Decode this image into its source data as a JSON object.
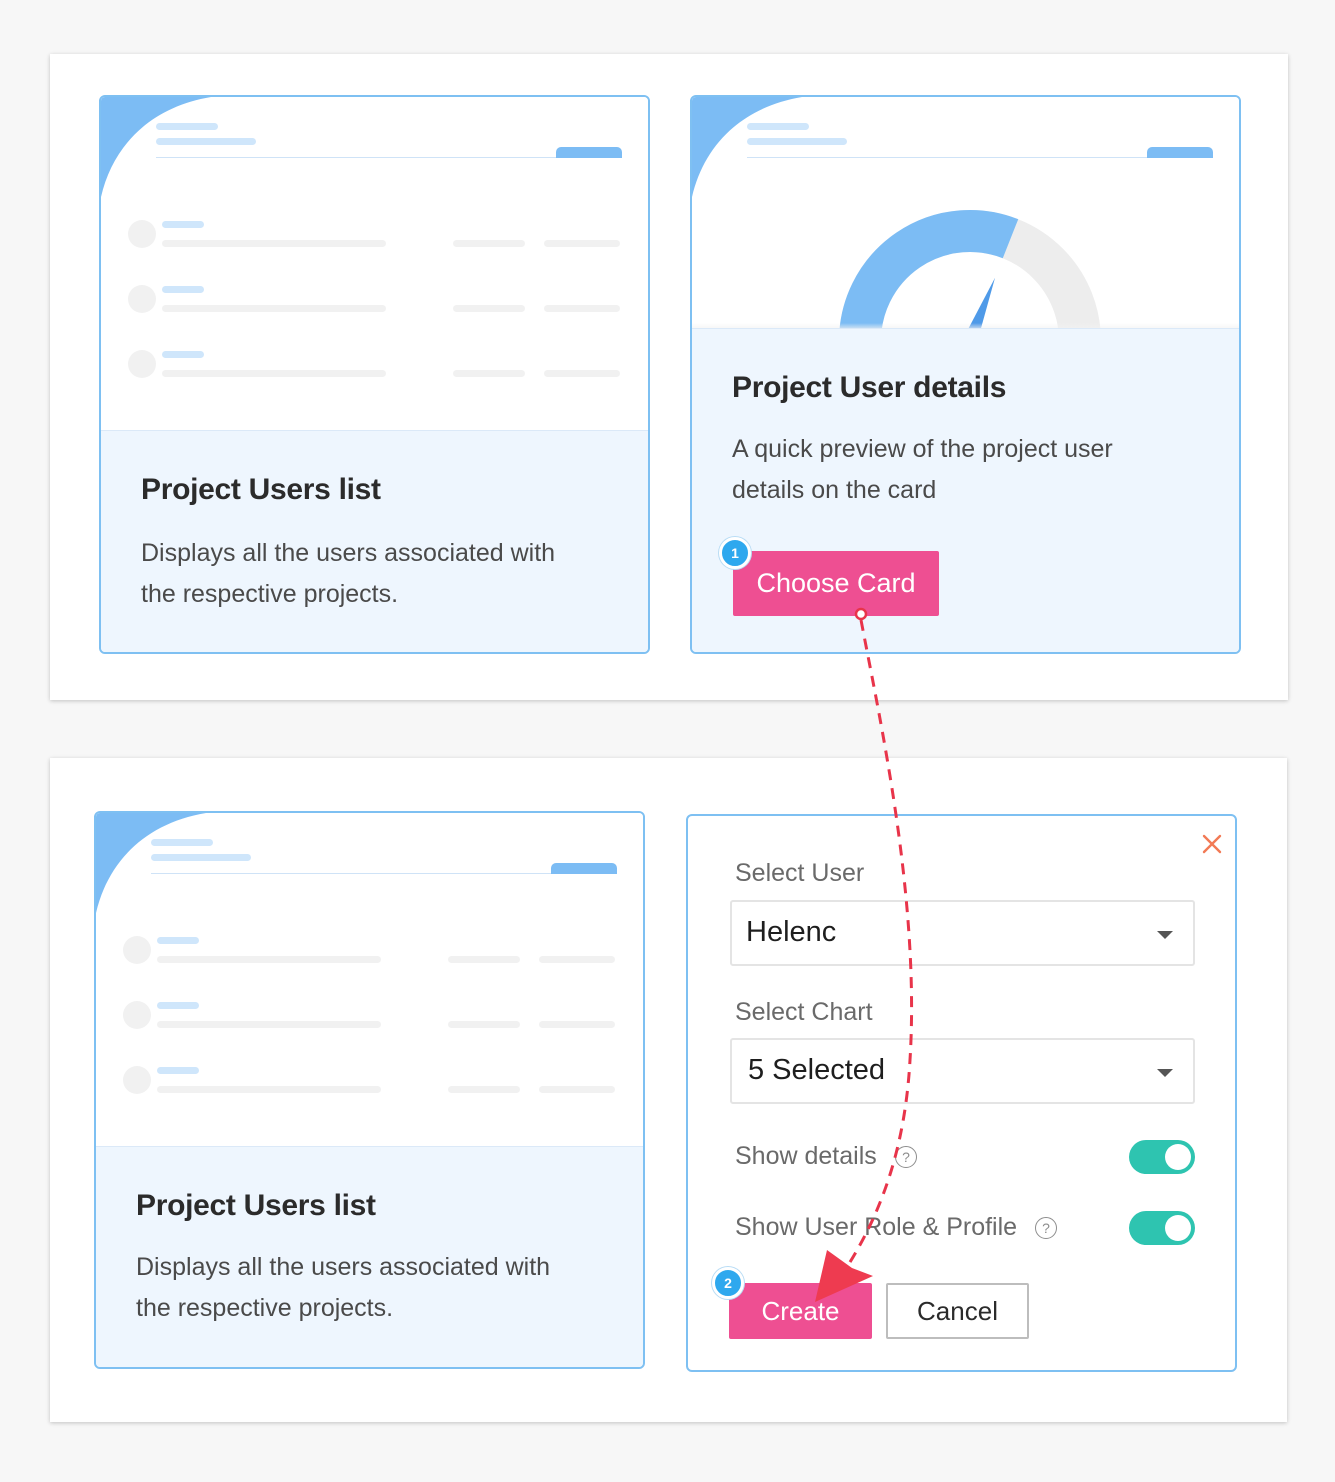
{
  "top": {
    "left_card": {
      "title": "Project Users list",
      "description": "Displays all the users associated with the respective projects."
    },
    "right_card": {
      "title": "Project User details",
      "description": "A quick preview of the project user details on the card",
      "choose_label": "Choose Card",
      "gauge_value": 0.62,
      "step": "1"
    }
  },
  "bottom": {
    "left_card": {
      "title": "Project Users list",
      "description": "Displays all the users associated with the respective projects."
    },
    "form": {
      "close_icon": "close-icon",
      "select_user_label": "Select User",
      "select_user_value": "Helenc",
      "select_chart_label": "Select Chart",
      "select_chart_value": "5 Selected",
      "show_details_label": "Show details",
      "show_details_on": true,
      "show_role_label": "Show User Role & Profile",
      "show_role_on": true,
      "create_label": "Create",
      "cancel_label": "Cancel",
      "step": "2",
      "help_glyph": "?"
    }
  },
  "colors": {
    "accent_pink": "#ee4f92",
    "accent_blue": "#7cbcf4",
    "toggle_teal": "#2ec4b0",
    "arrow_red": "#e8344a",
    "close_orange": "#f27a55"
  }
}
